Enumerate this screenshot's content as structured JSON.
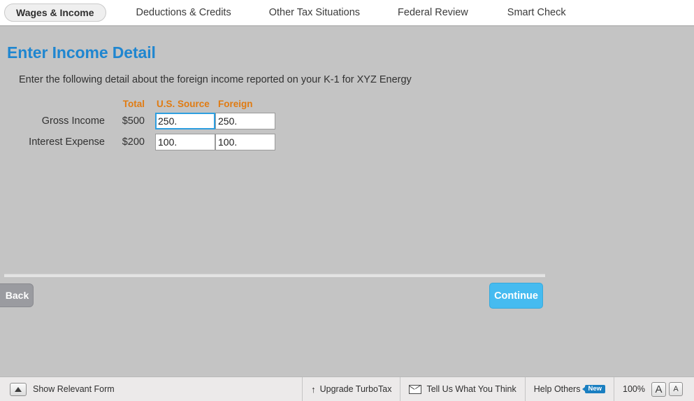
{
  "tabs": [
    {
      "label": "Wages & Income",
      "active": true
    },
    {
      "label": "Deductions & Credits",
      "active": false
    },
    {
      "label": "Other Tax Situations",
      "active": false
    },
    {
      "label": "Federal Review",
      "active": false
    },
    {
      "label": "Smart Check",
      "active": false
    }
  ],
  "page": {
    "title": "Enter Income Detail",
    "intro": "Enter the following detail about the foreign income reported on your K-1 for XYZ Energy"
  },
  "table": {
    "headers": {
      "label": "",
      "total": "Total",
      "us_source": "U.S. Source",
      "foreign": "Foreign"
    },
    "rows": [
      {
        "label": "Gross Income",
        "total": "$500",
        "us_source": "250.",
        "foreign": "250.",
        "focused": "us_source"
      },
      {
        "label": "Interest Expense",
        "total": "$200",
        "us_source": "100.",
        "foreign": "100.",
        "focused": ""
      }
    ]
  },
  "nav": {
    "back_label": "Back",
    "continue_label": "Continue"
  },
  "statusbar": {
    "show_form_label": "Show Relevant Form",
    "show_form_icon": "triangle-up-icon",
    "upgrade_label": "Upgrade TurboTax",
    "upgrade_icon": "arrow-up-icon",
    "upgrade_glyph": "↑",
    "feedback_label": "Tell Us What You Think",
    "feedback_icon": "envelope-icon",
    "help_others_label": "Help Others",
    "help_others_badge": "New",
    "zoom_level": "100%",
    "font_increase": "A",
    "font_decrease": "A"
  },
  "colors": {
    "accent_blue": "#1f86d0",
    "header_orange": "#e07b12",
    "continue_blue": "#46bbf0",
    "back_gray": "#9a9ba0",
    "badge_blue": "#1a7fc1",
    "body_gray": "#c4c4c4"
  }
}
